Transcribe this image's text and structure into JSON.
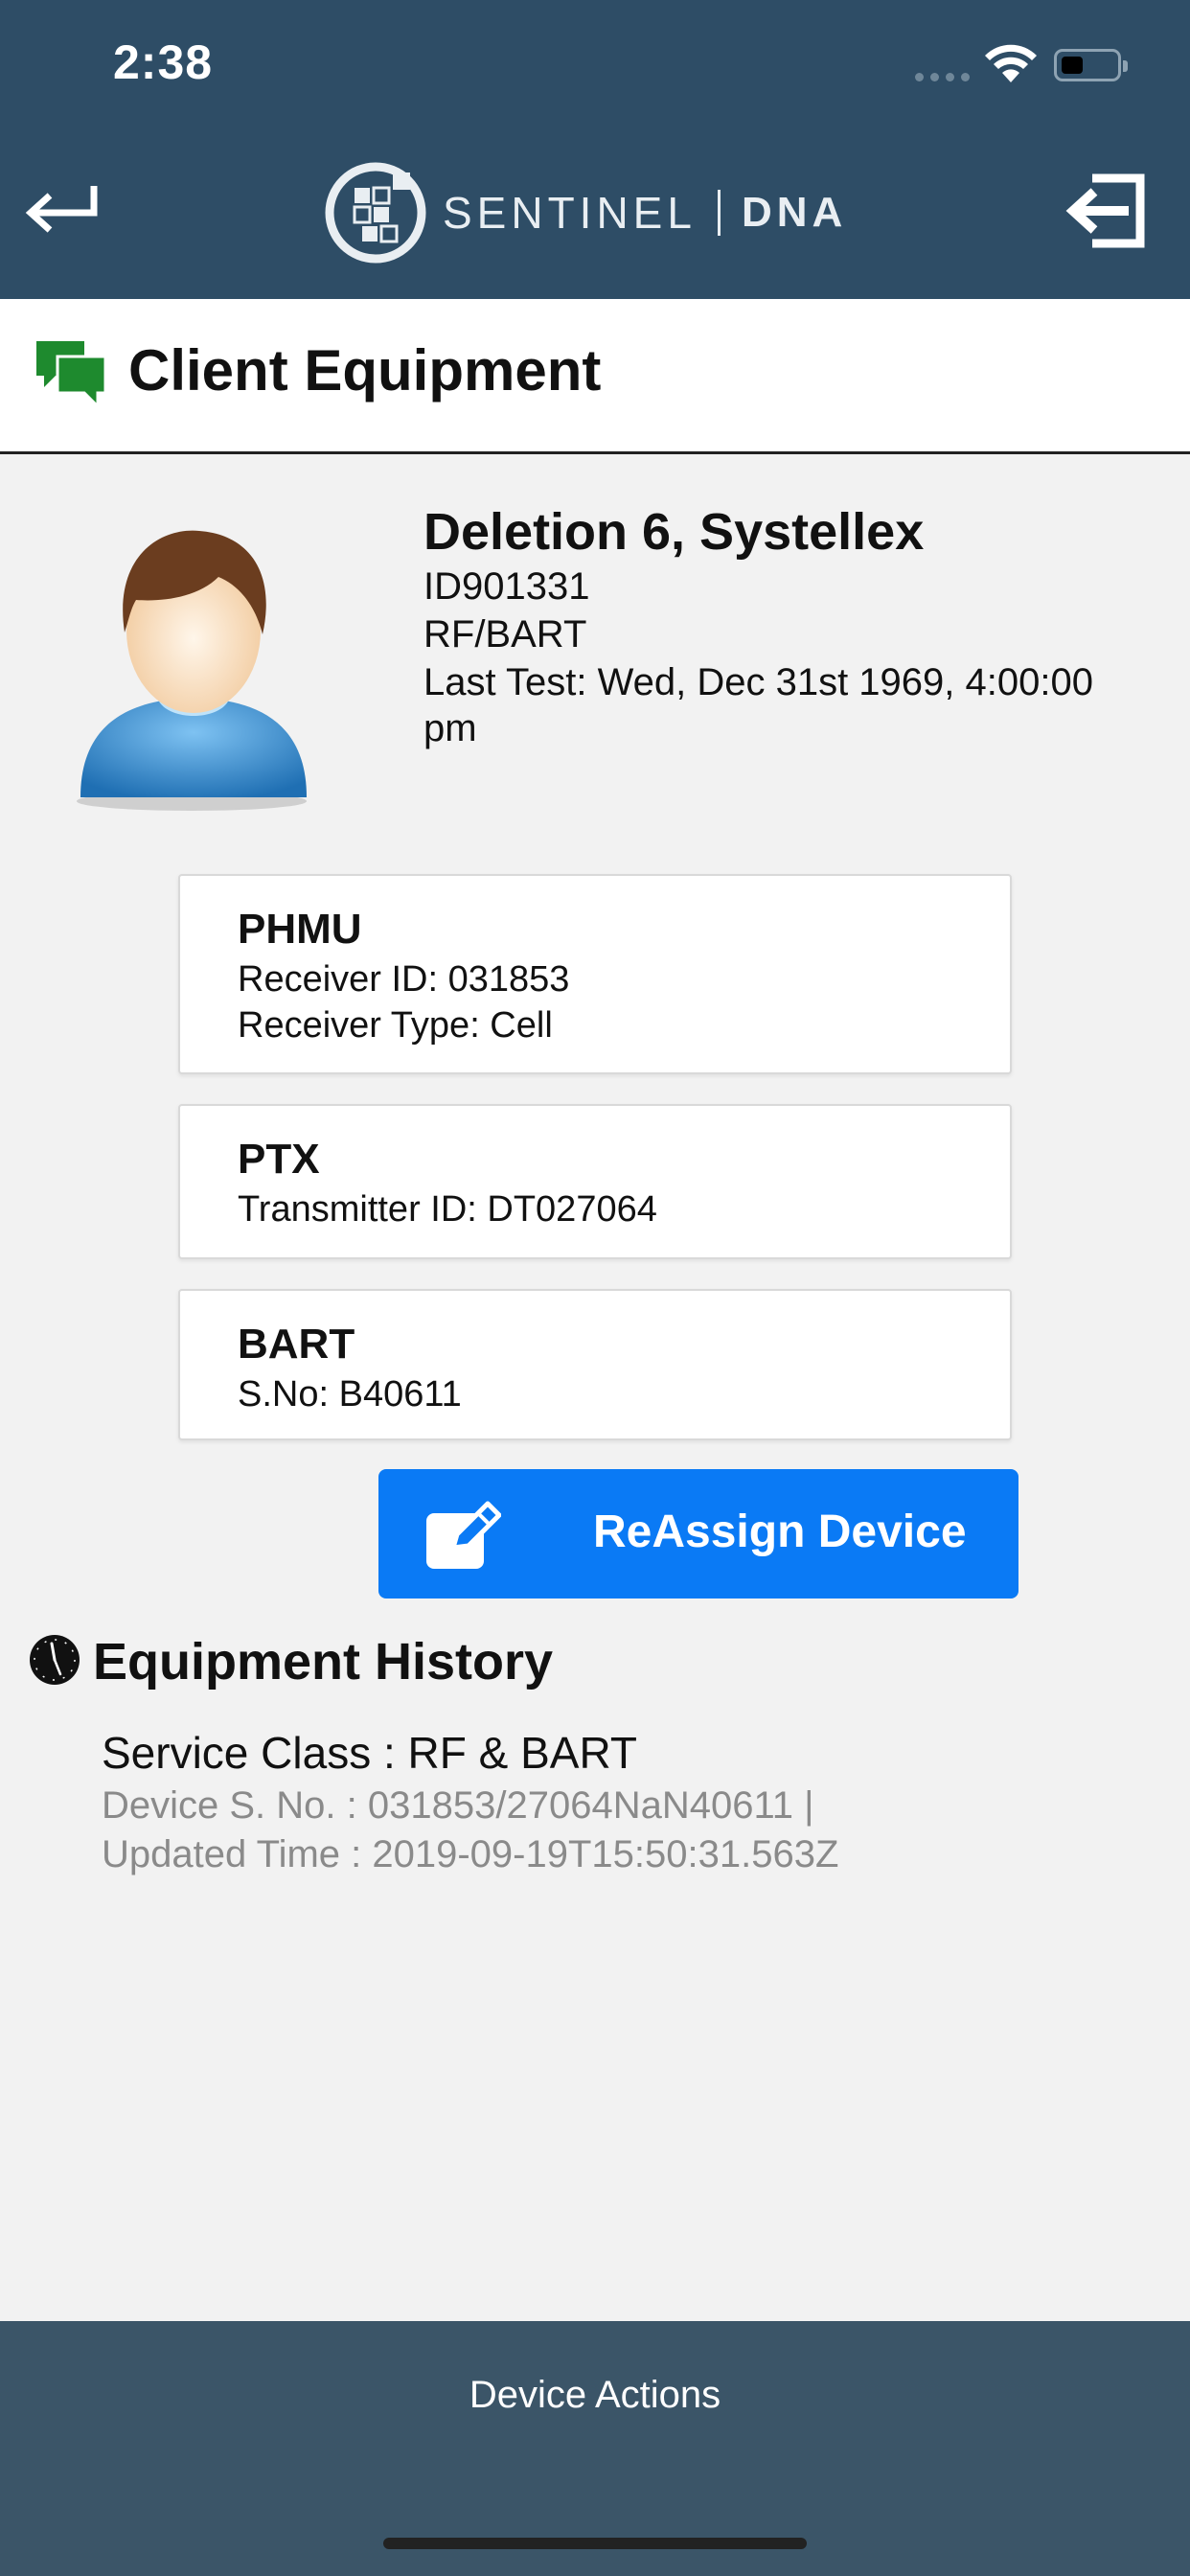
{
  "status_bar": {
    "time": "2:38"
  },
  "header": {
    "logo_word": "SENTINEL",
    "logo_dna": "DNA",
    "back_icon": "arrow-left-icon",
    "logout_icon": "logout-icon"
  },
  "title_bar": {
    "title": "Client Equipment",
    "icon": "chat-bubbles-icon"
  },
  "client": {
    "name": "Deletion 6, Systellex",
    "id": "ID901331",
    "service": "RF/BART",
    "last_test_line1": "Last Test: Wed, Dec 31st 1969, 4:00:00",
    "last_test_line2": "pm"
  },
  "equipment": [
    {
      "title": "PHMU",
      "lines": [
        "Receiver ID: 031853",
        "Receiver Type: Cell"
      ]
    },
    {
      "title": "PTX",
      "lines": [
        "Transmitter ID: DT027064"
      ]
    },
    {
      "title": "BART",
      "lines": [
        "S.No: B40611"
      ]
    }
  ],
  "reassign": {
    "label": "ReAssign Device",
    "icon": "edit-icon"
  },
  "history": {
    "title": "Equipment History",
    "icon": "clock-icon",
    "service_class": "Service Class : RF & BART",
    "device_serial": "Device S. No. : 031853/27064NaN40611 |",
    "updated_time": "Updated Time : 2019-09-19T15:50:31.563Z"
  },
  "bottom_bar": {
    "label": "Device Actions"
  },
  "colors": {
    "header_bg": "#2e4d66",
    "bottom_bg": "#3b5568",
    "accent": "#0a7af5",
    "chat_icon": "#1e8a2e"
  }
}
